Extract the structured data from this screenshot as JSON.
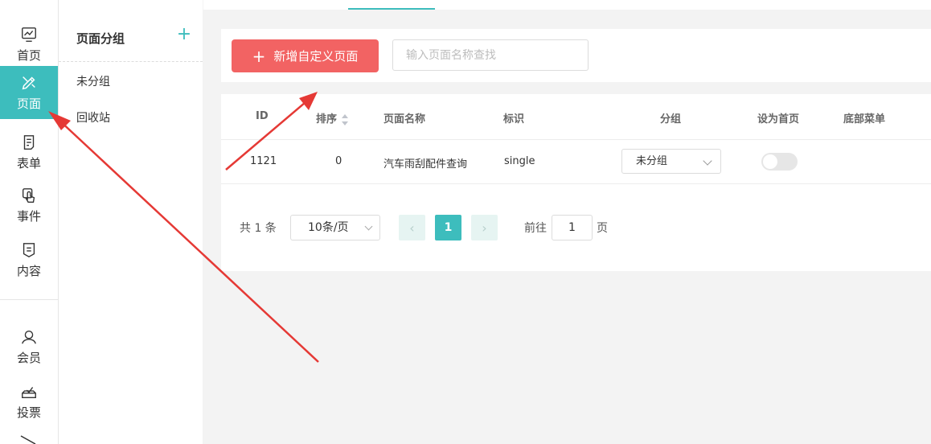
{
  "nav": {
    "items": [
      {
        "label": "首页",
        "icon": "dashboard-icon"
      },
      {
        "label": "页面",
        "icon": "design-tools-icon"
      },
      {
        "label": "表单",
        "icon": "form-icon"
      },
      {
        "label": "事件",
        "icon": "touch-icon"
      },
      {
        "label": "内容",
        "icon": "content-icon"
      },
      {
        "label": "会员",
        "icon": "user-icon"
      },
      {
        "label": "投票",
        "icon": "vote-icon"
      }
    ],
    "active": "页面"
  },
  "groups": {
    "title": "页面分组",
    "add_symbol": "+",
    "items": [
      "未分组",
      "回收站"
    ]
  },
  "toolbar": {
    "new_button": "新增自定义页面",
    "plus_symbol": "+",
    "search_placeholder": "输入页面名称查找"
  },
  "table": {
    "columns": [
      "ID",
      "排序",
      "页面名称",
      "标识",
      "分组",
      "设为首页",
      "底部菜单"
    ],
    "rows": [
      {
        "id": "1121",
        "sort": "0",
        "name": "汽车雨刮配件查询",
        "key": "single",
        "group": "未分组",
        "homepage": false
      }
    ]
  },
  "pagination": {
    "total_text": "共 1 条",
    "page_size": "10条/页",
    "prev_symbol": "‹",
    "next_symbol": "›",
    "current_page": "1",
    "goto_label": "前往",
    "goto_value": "1",
    "page_suffix": "页"
  },
  "colors": {
    "accent": "#3dbdbd",
    "primary_button": "#f26363",
    "annotation_arrow": "#e53935"
  }
}
